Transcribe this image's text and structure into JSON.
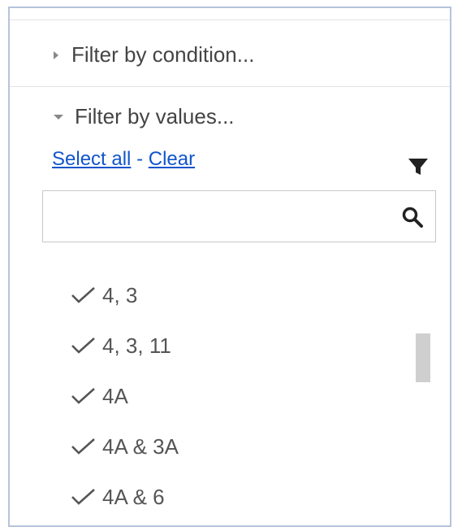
{
  "filter_condition": {
    "label": "Filter by condition..."
  },
  "filter_values": {
    "label": "Filter by values...",
    "select_all": "Select all",
    "separator": "-",
    "clear": "Clear"
  },
  "search": {
    "value": "",
    "placeholder": ""
  },
  "values": [
    {
      "label": "4, 3",
      "checked": true
    },
    {
      "label": "4, 3, 11",
      "checked": true
    },
    {
      "label": "4A",
      "checked": true
    },
    {
      "label": "4A & 3A",
      "checked": true
    },
    {
      "label": "4A & 6",
      "checked": true
    }
  ],
  "icons": {
    "filter": "filter-funnel-icon",
    "search": "search-icon",
    "check": "check-icon",
    "caret_right": "caret-right-icon",
    "caret_down": "caret-down-icon"
  },
  "colors": {
    "link": "#1155cc",
    "border": "#b5c4dc",
    "scrollbar": "#cfcfcf"
  }
}
